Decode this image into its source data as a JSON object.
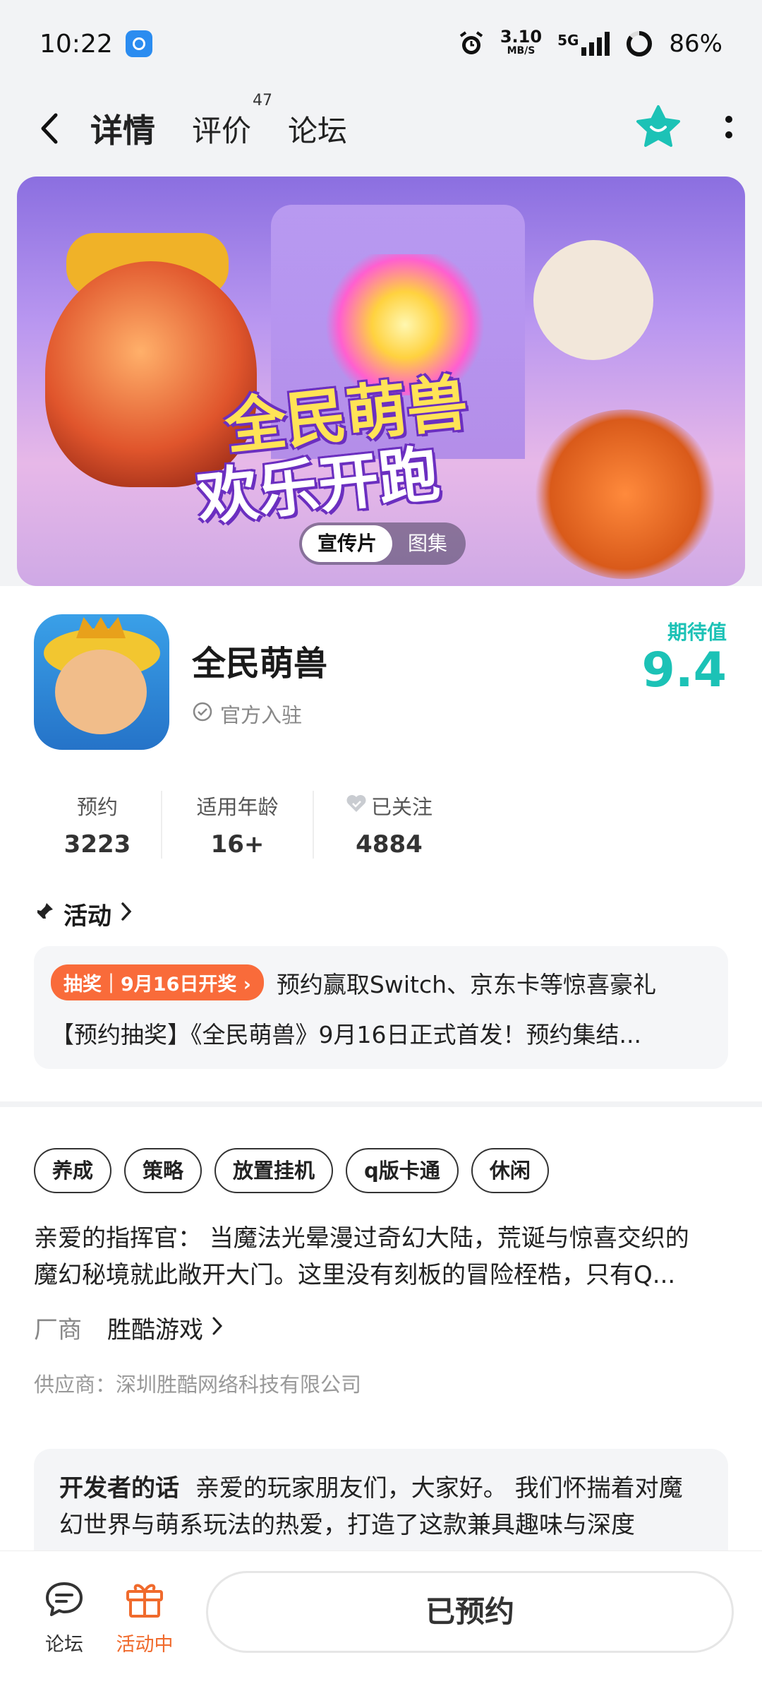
{
  "status": {
    "time": "10:22",
    "net_speed_value": "3.10",
    "net_speed_unit": "MB/S",
    "network": "5G",
    "battery": "86%"
  },
  "nav": {
    "tabs": [
      {
        "label": "详情",
        "active": true
      },
      {
        "label": "评价",
        "badge": "47"
      },
      {
        "label": "论坛"
      }
    ]
  },
  "banner": {
    "title_line1": "全民萌兽",
    "title_line2": "欢乐开跑",
    "media_tabs": [
      "宣传片",
      "图集"
    ]
  },
  "game": {
    "name": "全民萌兽",
    "official": "官方入驻",
    "expect_label": "期待值",
    "expect_score": "9.4"
  },
  "stats": [
    {
      "label": "预约",
      "value": "3223"
    },
    {
      "label": "适用年龄",
      "value": "16+"
    },
    {
      "label": "已关注",
      "value": "4884"
    }
  ],
  "activity": {
    "heading": "活动",
    "badge": "抽奖｜9月16日开奖",
    "title": "预约赢取Switch、京东卡等惊喜豪礼",
    "desc": "【预约抽奖】《全民萌兽》9月16日正式首发！预约集结..."
  },
  "tags": [
    "养成",
    "策略",
    "放置挂机",
    "q版卡通",
    "休闲"
  ],
  "description": {
    "line1": "亲爱的指挥官： 当魔法光晕漫过奇幻大陆，荒诞与惊喜交织的",
    "line2": "魔幻秘境就此敞开大门。这里没有刻板的冒险桎梏，只有Q..."
  },
  "vendor": {
    "label": "厂商",
    "name": "胜酷游戏",
    "supplier": "供应商：深圳胜酷网络科技有限公司"
  },
  "developer": {
    "heading": "开发者的话",
    "text": "亲爱的玩家朋友们，大家好。 我们怀揣着对魔幻世界与萌系玩法的热爱，打造了这款兼具趣味与深度"
  },
  "bottom": {
    "forum_label": "论坛",
    "activity_label": "活动中",
    "reserve_label": "已预约"
  },
  "colors": {
    "accent": "#1cc2b6",
    "orange": "#f96b3a"
  }
}
